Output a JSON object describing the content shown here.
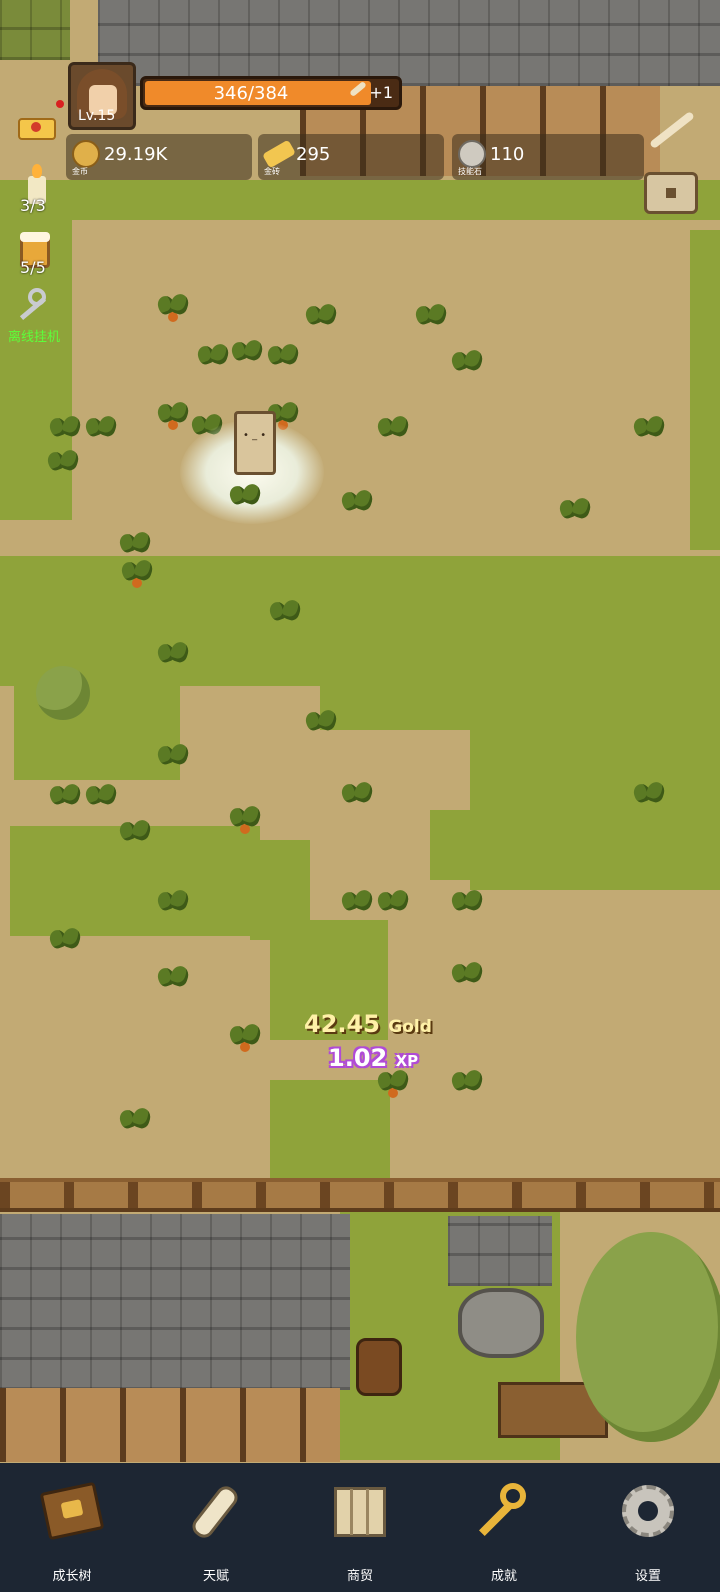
{
  "player": {
    "level_label": "Lv.15",
    "hp_text": "346/384",
    "hp_fraction": 0.9,
    "hp_regen": "+1"
  },
  "resources": [
    {
      "name": "gold-coin-icon",
      "value": "29.19K",
      "sub": "金币"
    },
    {
      "name": "gold-bar-icon",
      "value": "295",
      "sub": "金砖"
    },
    {
      "name": "skill-stone-icon",
      "value": "110",
      "sub": "技能石"
    }
  ],
  "side": {
    "candle_count": "3/3",
    "beer_count": "5/5",
    "auto_label": "离线挂机"
  },
  "floating": {
    "gold_value": "42.45",
    "gold_unit": "Gold",
    "xp_value": "1.02",
    "xp_unit": "XP"
  },
  "nav": [
    {
      "label": "成长树",
      "icon": "book-icon"
    },
    {
      "label": "天赋",
      "icon": "scroll-icon"
    },
    {
      "label": "商贸",
      "icon": "map-icon"
    },
    {
      "label": "成就",
      "icon": "key-icon"
    },
    {
      "label": "设置",
      "icon": "gear-icon"
    }
  ],
  "colors": {
    "hp_fill": "#f08a2a",
    "nav_bg": "#1d2633",
    "auto_label": "#5cff3a",
    "xp_outline": "#b04bd6"
  }
}
